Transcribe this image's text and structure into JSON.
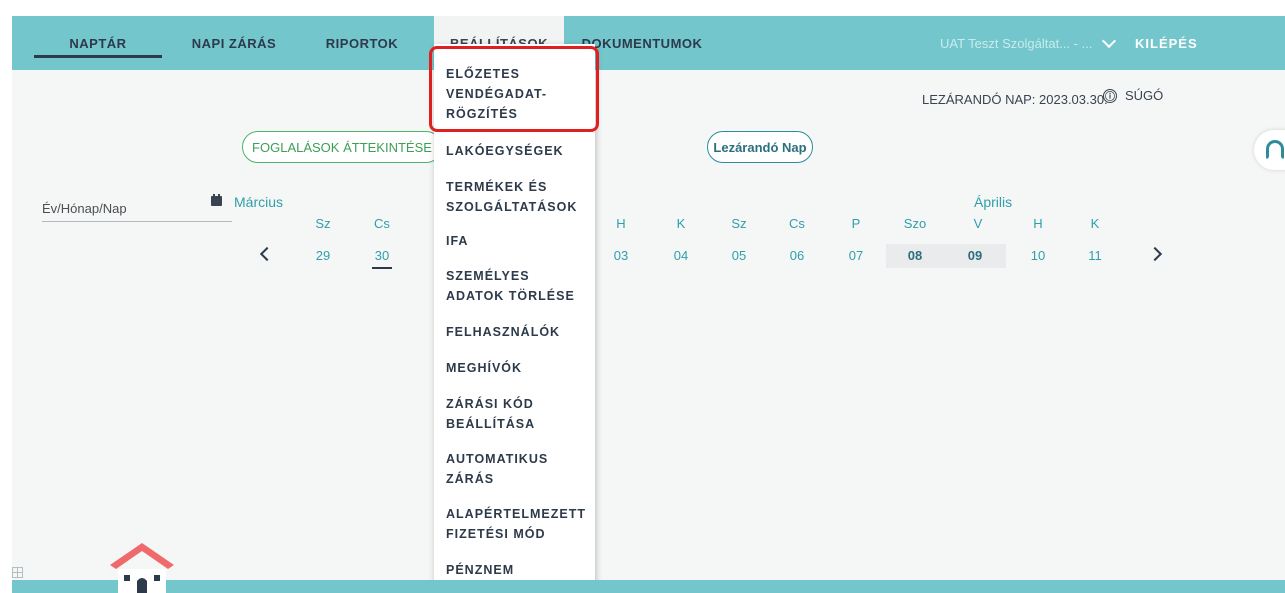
{
  "nav": {
    "calendar": "NAPTÁR",
    "daily_close": "NAPI ZÁRÁS",
    "reports": "RIPORTOK",
    "settings": "BEÁLLÍTÁSOK",
    "documents": "DOKUMENTUMOK",
    "user_select": "UAT Teszt Szolgáltat... - ...",
    "logout": "KILÉPÉS"
  },
  "header": {
    "closing_day": "LEZÁRANDÓ NAP: 2023.03.30.",
    "help": "SÚGÓ",
    "info_glyph": "ⓘ"
  },
  "buttons": {
    "bookings_overview": "FOGLALÁSOK ÁTTEKINTÉSE",
    "closing_day": "Lezárandó Nap"
  },
  "date_input": {
    "placeholder": "Év/Hónap/Nap"
  },
  "calendar": {
    "months": {
      "march": "Március",
      "april": "Április"
    },
    "left_days": [
      {
        "dow": "Sz",
        "day": "29"
      },
      {
        "dow": "Cs",
        "day": "30"
      }
    ],
    "right_days": [
      {
        "dow": "H",
        "day": "03"
      },
      {
        "dow": "K",
        "day": "04"
      },
      {
        "dow": "Sz",
        "day": "05"
      },
      {
        "dow": "Cs",
        "day": "06"
      },
      {
        "dow": "P",
        "day": "07"
      },
      {
        "dow": "Szo",
        "day": "08"
      },
      {
        "dow": "V",
        "day": "09"
      },
      {
        "dow": "H",
        "day": "10"
      },
      {
        "dow": "K",
        "day": "11"
      }
    ]
  },
  "settings_menu": {
    "items": [
      "ELŐZETES\nVENDÉGADAT-\nRÖGZÍTÉS",
      "LAKÓEGYSÉGEK",
      "TERMÉKEK ÉS\nSZOLGÁLTATÁSOK",
      "IFA",
      "SZEMÉLYES\nADATOK TÖRLÉSE",
      "FELHASZNÁLÓK",
      "MEGHÍVÓK",
      "ZÁRÁSI KÓD\nBEÁLLÍTÁSA",
      "AUTOMATIKUS\nZÁRÁS",
      "ALAPÉRTELMEZETT\nFIZETÉSI MÓD",
      "PÉNZNEM\nBEÁLLÍTÁSA"
    ],
    "highlighted_index": 0
  },
  "colors": {
    "topbar": "#73c6cc",
    "accent_teal": "#2f9faa",
    "green": "#4cb46a",
    "highlight_red": "#e02020"
  },
  "icons": {
    "user_chevron": "chevron-down-icon",
    "help": "info-icon",
    "calendar": "calendar-icon",
    "prev": "chevron-left-icon",
    "next": "chevron-right-icon",
    "support": "headset-icon",
    "house": "house-icon",
    "grid": "grid-icon"
  }
}
